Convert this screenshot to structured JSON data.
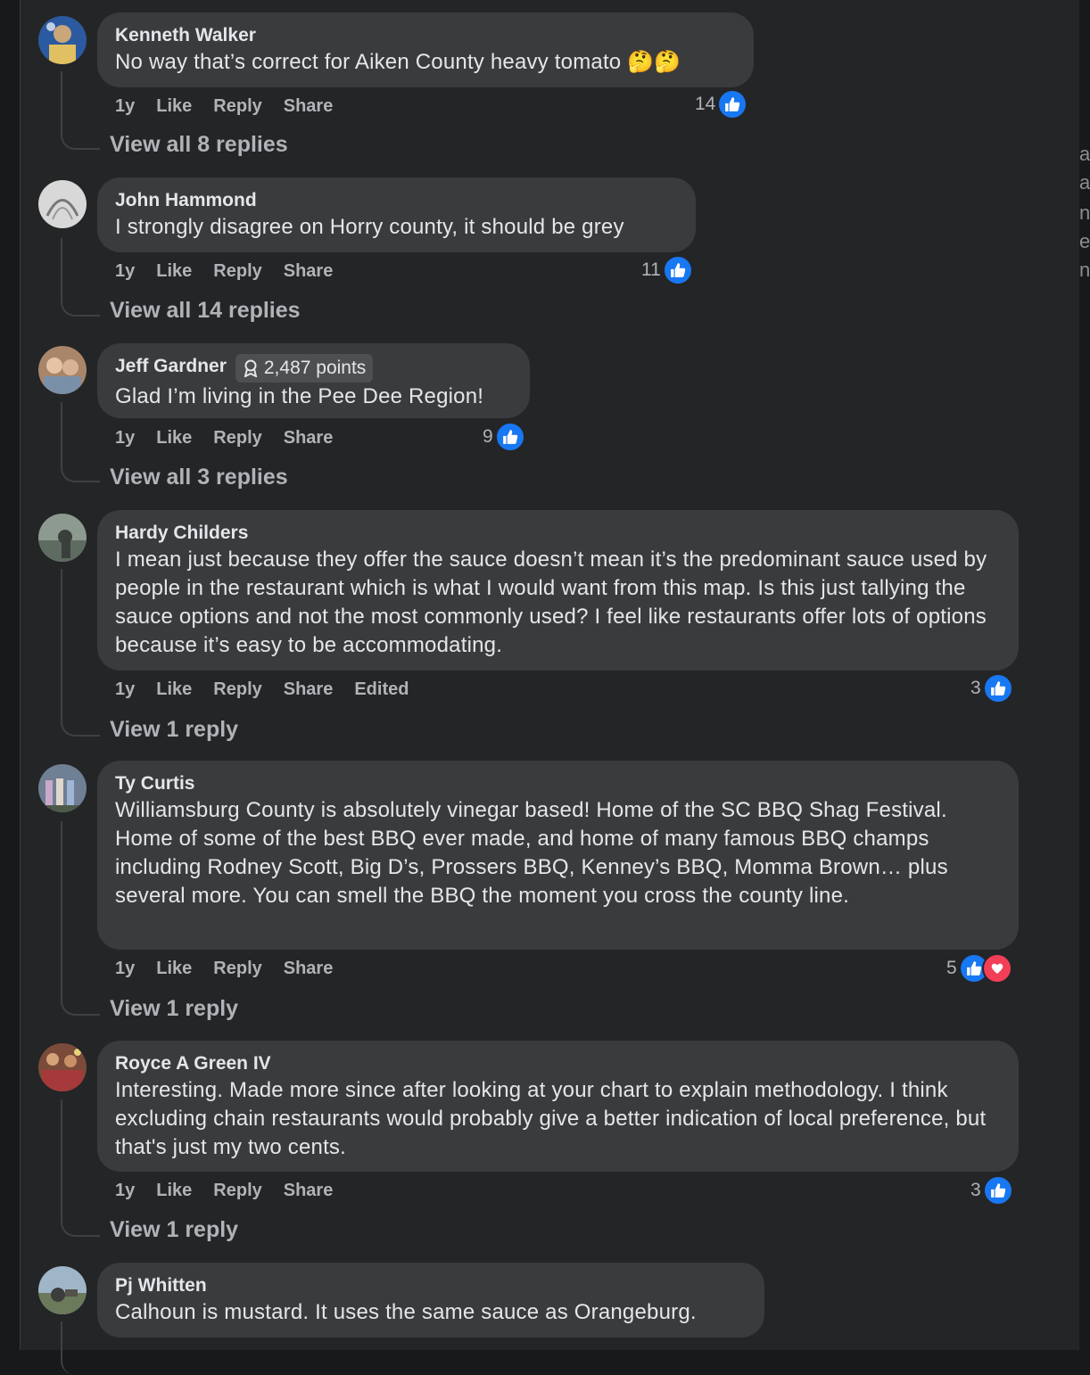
{
  "action_labels": {
    "time": "1y",
    "like": "Like",
    "reply": "Reply",
    "share": "Share"
  },
  "comments": [
    {
      "author": "Kenneth Walker",
      "text": "No way that’s correct for Aiken County heavy tomato 🤔🤔",
      "reaction_count": "14",
      "view_replies": "View all 8 replies"
    },
    {
      "author": "John Hammond",
      "text": "I strongly disagree on Horry county, it should be grey",
      "reaction_count": "11",
      "view_replies": "View all 14 replies"
    },
    {
      "author": "Jeff Gardner",
      "badge": "2,487 points",
      "text": "Glad I’m living in the Pee Dee Region!",
      "reaction_count": "9",
      "view_replies": "View all 3 replies"
    },
    {
      "author": "Hardy Childers",
      "text": "I mean just because they offer the sauce doesn’t mean it’s the predominant sauce used by people in the restaurant which is what I would want from this map. Is this just tallying the sauce options and not the most commonly used? I feel like restaurants offer lots of options because it’s easy to be accommodating.",
      "edited": "Edited",
      "reaction_count": "3",
      "view_replies": "View 1 reply"
    },
    {
      "author": "Ty Curtis",
      "text": "Williamsburg County is absolutely vinegar based! Home of the SC BBQ Shag Festival. Home of some of the best BBQ ever made, and home of many famous BBQ champs including Rodney Scott, Big D’s, Prossers BBQ, Kenney’s BBQ, Momma Brown… plus several more. You can smell the BBQ the moment you cross the county line.",
      "reaction_count": "5",
      "view_replies": "View 1 reply"
    },
    {
      "author": "Royce A Green IV",
      "text": "Interesting. Made more since after looking at your chart to explain methodology. I think excluding chain restaurants would probably give a better indication of local preference, but that's just my two cents.",
      "reaction_count": "3",
      "view_replies": "View 1 reply"
    },
    {
      "author": "Pj Whitten",
      "text": "Calhoun is mustard. It uses the same sauce as Orangeburg."
    }
  ],
  "colors": {
    "like_blue": "#1877f2",
    "love_red": "#f33e58",
    "bubble": "#3a3b3c",
    "panel": "#242526"
  },
  "icons": {
    "like": "thumbs-up-icon",
    "love": "heart-icon",
    "badge": "award-ribbon-icon"
  }
}
